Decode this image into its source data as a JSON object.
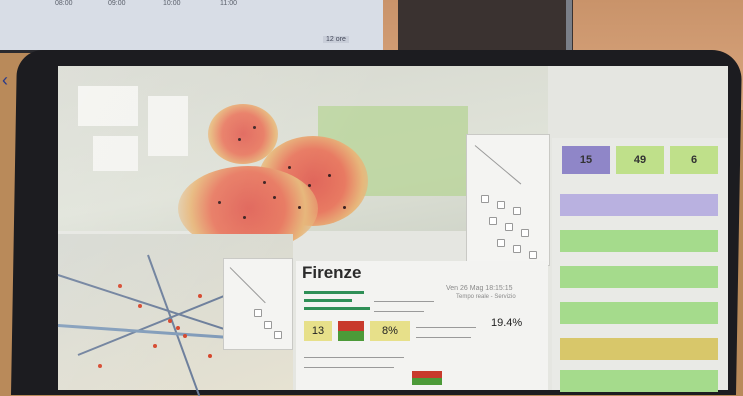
{
  "background_monitor": {
    "ticks": [
      "08:00",
      "09:00",
      "10:00",
      "11:00"
    ],
    "zoom_label": "12 ore",
    "chevron": "‹"
  },
  "dashboard": {
    "city_name": "Firenze",
    "date_text": "Ven 26 Mag 18:15:15",
    "source_text": "Tempo reale - Servizio",
    "right_panel_kpis": [
      "15",
      "49",
      "6"
    ],
    "city_kpis": [
      "13",
      "8%"
    ],
    "city_percentage": "19.4%"
  },
  "colors": {
    "heat_core": "#e0655a",
    "heat_edge": "#e7b77b",
    "kpi_purple": "#8f86c8",
    "kpi_green": "#bfe08a",
    "bar_green": "#a5db8c",
    "bar_yellow": "#d8c76a",
    "bar_lavender": "#b9b1e0"
  }
}
